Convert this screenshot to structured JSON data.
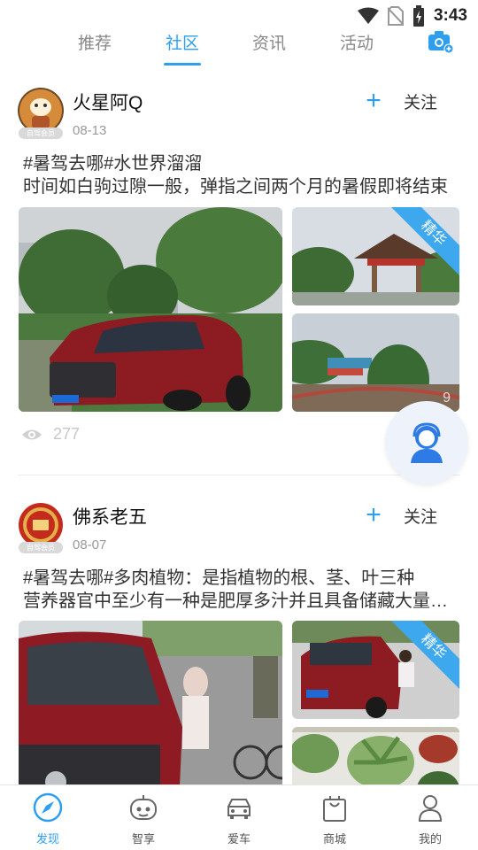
{
  "status_bar": {
    "time": "3:43"
  },
  "top_tabs": [
    {
      "label": "推荐"
    },
    {
      "label": "社区",
      "active": true
    },
    {
      "label": "资讯"
    },
    {
      "label": "活动"
    }
  ],
  "posts": [
    {
      "username": "火星阿Q",
      "member_tag": "自驾会员",
      "date": "08-13",
      "follow_label": "关注",
      "text_line1": "#暑驾去哪#水世界溜溜",
      "text_line2": "时间如白驹过隙一般，弹指之间两个月的暑假即将结束",
      "badge": "精华",
      "image_count": "9",
      "views": "277"
    },
    {
      "username": "佛系老五",
      "member_tag": "自驾会员",
      "date": "08-07",
      "follow_label": "关注",
      "text_line1": "#暑驾去哪#多肉植物：是指植物的根、茎、叶三种",
      "text_line2": "营养器官中至少有一种是肥厚多汁并且具备储藏大量水分",
      "badge": "精华"
    }
  ],
  "bottom_nav": [
    {
      "label": "发现",
      "icon": "compass-icon",
      "active": true
    },
    {
      "label": "智享",
      "icon": "robot-icon"
    },
    {
      "label": "爱车",
      "icon": "car-icon"
    },
    {
      "label": "商城",
      "icon": "shopping-bag-icon"
    },
    {
      "label": "我的",
      "icon": "user-icon"
    }
  ],
  "colors": {
    "accent": "#2e9ef1",
    "badge": "#3ea8ef"
  }
}
